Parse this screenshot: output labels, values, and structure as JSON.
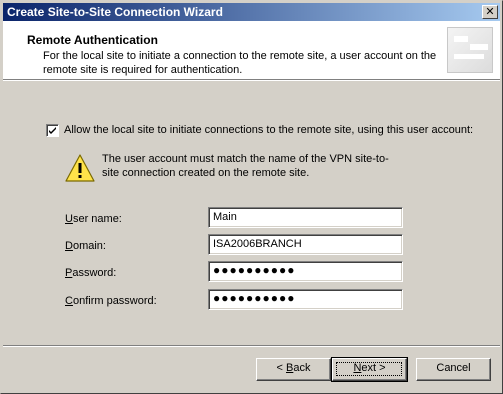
{
  "window": {
    "title": "Create Site-to-Site Connection Wizard"
  },
  "header": {
    "title": "Remote Authentication",
    "description": "For the local site to initiate a connection to the remote site, a user account on the remote site is required for authentication."
  },
  "allow_checkbox": {
    "checked": true,
    "label": "Allow the local site to initiate connections to the remote site, using this user account:"
  },
  "warning": {
    "text": "The user account must match the name of the VPN site-to-site connection created on the remote site."
  },
  "fields": {
    "username": {
      "label_prefix": "U",
      "label_rest": "ser name:",
      "value": "Main"
    },
    "domain": {
      "label_prefix": "D",
      "label_rest": "omain:",
      "value": "ISA2006BRANCH"
    },
    "password": {
      "label_prefix": "P",
      "label_rest": "assword:",
      "value": "●●●●●●●●●●"
    },
    "confirm_password": {
      "label_prefix": "C",
      "label_rest": "onfirm password:",
      "value": "●●●●●●●●●●"
    }
  },
  "buttons": {
    "back": {
      "prefix": "< ",
      "mnemonic": "B",
      "rest": "ack"
    },
    "next": {
      "mnemonic": "N",
      "rest": "ext >"
    },
    "cancel": {
      "label": "Cancel"
    }
  }
}
